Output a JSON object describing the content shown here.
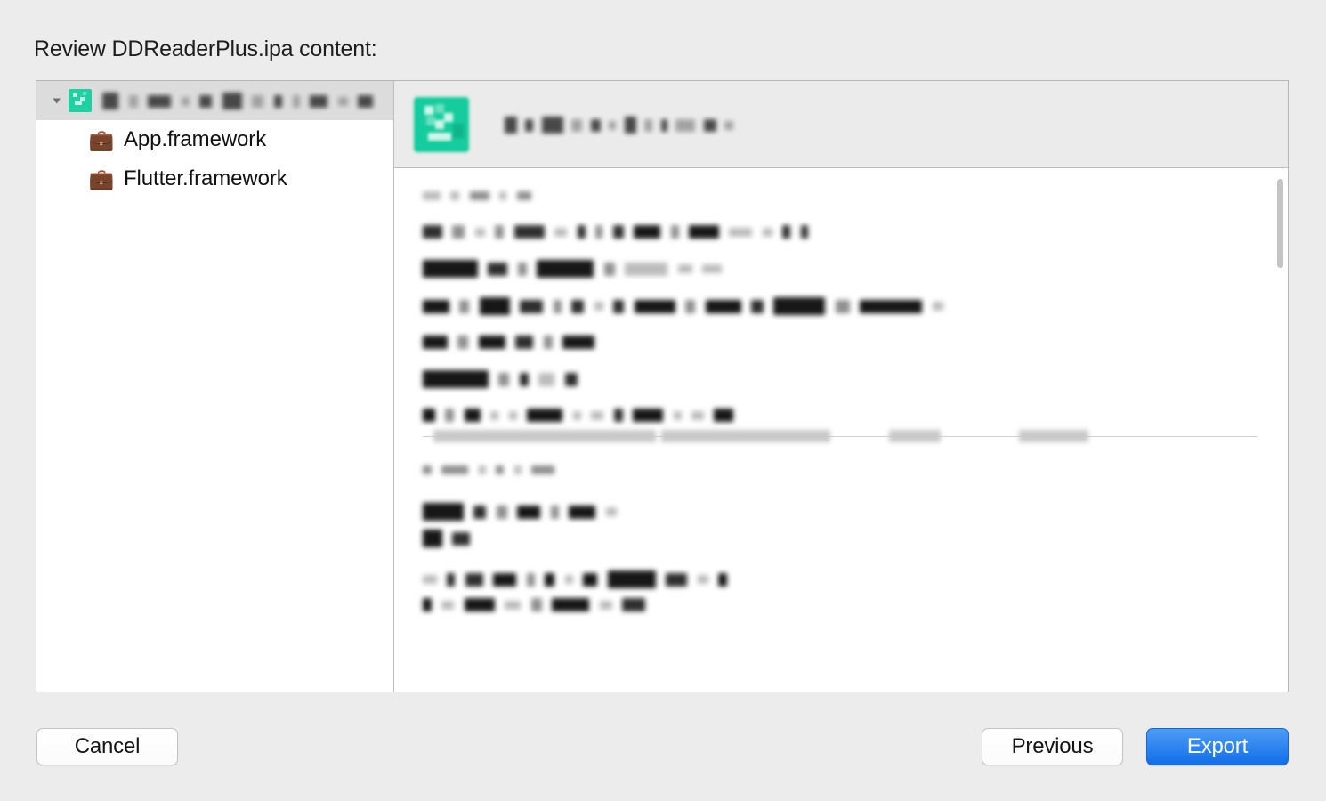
{
  "dialog": {
    "title": "Review DDReaderPlus.ipa content:"
  },
  "tree": {
    "root": {
      "label_redacted": true,
      "icon": "app-teal-icon",
      "expanded": true,
      "selected": true
    },
    "children": [
      {
        "icon": "briefcase-icon",
        "glyph": "💼",
        "label": "App.framework"
      },
      {
        "icon": "briefcase-icon",
        "glyph": "💼",
        "label": "Flutter.framework"
      }
    ]
  },
  "detail": {
    "header": {
      "icon": "app-teal-icon",
      "title_redacted": true
    },
    "sections": [
      {
        "heading_redacted": true,
        "lines_redacted": 6,
        "visible_fragments": [
          ".64"
        ]
      },
      {
        "heading_redacted": true,
        "visible_fragments": [
          "get",
          "fa"
        ],
        "lines_redacted": 4
      }
    ]
  },
  "footer": {
    "cancel_label": "Cancel",
    "previous_label": "Previous",
    "export_label": "Export"
  },
  "colors": {
    "background": "#ececec",
    "panel": "#ffffff",
    "panel_border": "#b6b6b6",
    "selection": "#dcdcdc",
    "header_bar": "#ebebeb",
    "app_icon_teal": "#14cc9d",
    "primary_button": "#1d7ef0",
    "briefcase_yellow": "#f0b429"
  }
}
